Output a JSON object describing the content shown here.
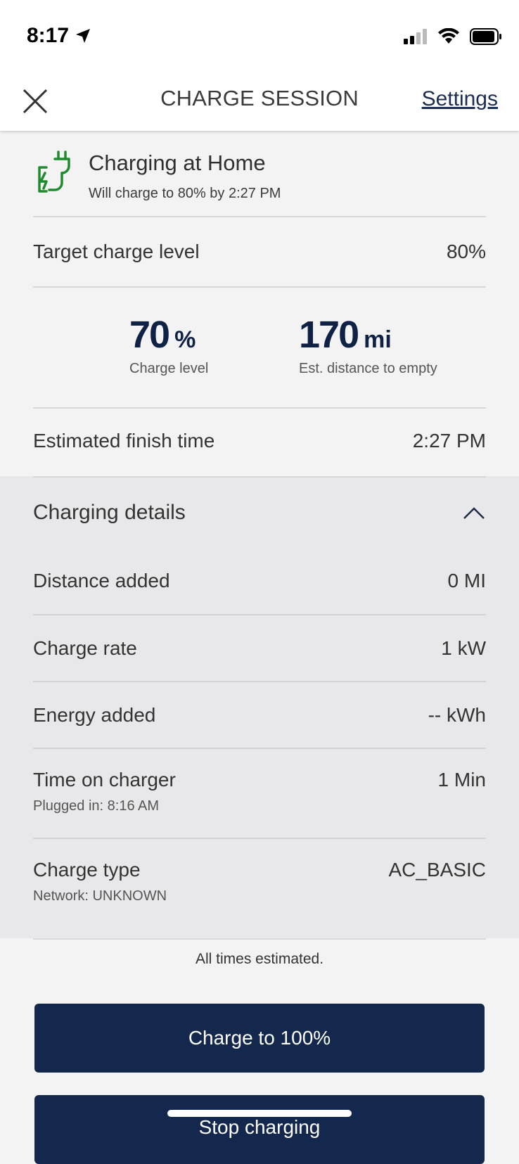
{
  "status_bar": {
    "time": "8:17"
  },
  "nav": {
    "title": "CHARGE SESSION",
    "settings_label": "Settings"
  },
  "header": {
    "title": "Charging at Home",
    "subtitle": "Will charge to 80% by 2:27 PM"
  },
  "target": {
    "label": "Target charge level",
    "value": "80%"
  },
  "stats": {
    "charge": {
      "value": "70",
      "unit": "%",
      "label": "Charge level"
    },
    "distance": {
      "value": "170",
      "unit": "mi",
      "label": "Est. distance to empty"
    }
  },
  "finish": {
    "label": "Estimated finish time",
    "value": "2:27 PM"
  },
  "details": {
    "title": "Charging details",
    "rows": [
      {
        "label": "Distance added",
        "value": "0 MI"
      },
      {
        "label": "Charge rate",
        "value": "1 kW"
      },
      {
        "label": "Energy added",
        "value": "-- kWh"
      },
      {
        "label": "Time on charger",
        "sub": "Plugged in: 8:16 AM",
        "value": "1 Min"
      },
      {
        "label": "Charge type",
        "sub": "Network: UNKNOWN",
        "value": "AC_BASIC"
      }
    ]
  },
  "footnote": "All times estimated.",
  "buttons": {
    "charge_100": "Charge to 100%",
    "stop": "Stop charging"
  },
  "colors": {
    "primary": "#14284d",
    "plug_icon": "#1f8a2e"
  }
}
